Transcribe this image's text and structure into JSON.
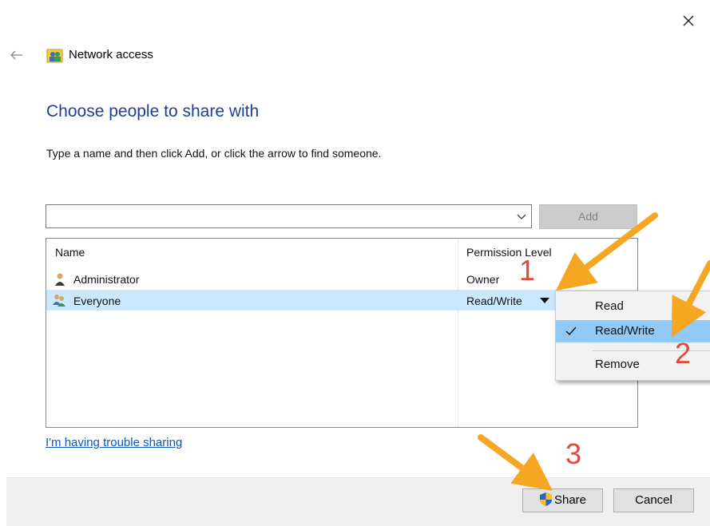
{
  "window": {
    "title": "Network access",
    "close_icon": "close-icon",
    "back_icon": "back-arrow-icon",
    "title_icon": "network-users-icon"
  },
  "main": {
    "heading": "Choose people to share with",
    "instruction": "Type a name and then click Add, or click the arrow to find someone.",
    "name_input": {
      "value": "",
      "placeholder": ""
    },
    "add_label": "Add",
    "trouble_link": "I'm having trouble sharing"
  },
  "list": {
    "columns": [
      "Name",
      "Permission Level"
    ],
    "rows": [
      {
        "name": "Administrator",
        "permission": "Owner",
        "icon": "user-icon",
        "selected": false
      },
      {
        "name": "Everyone",
        "permission": "Read/Write",
        "icon": "group-users-icon",
        "selected": true
      }
    ]
  },
  "context_menu": {
    "items": [
      {
        "label": "Read",
        "checked": false
      },
      {
        "label": "Read/Write",
        "checked": true
      },
      {
        "label": "Remove",
        "checked": false
      }
    ]
  },
  "footer": {
    "share_label": "Share",
    "cancel_label": "Cancel"
  },
  "annotations": {
    "steps": [
      "1",
      "2",
      "3"
    ],
    "arrow_color": "#f5a623",
    "number_color": "#e04a3c"
  },
  "colors": {
    "heading": "#1e3f9a",
    "selection": "#cce8ff",
    "menu_highlight": "#91c9f7",
    "link": "#0a58b8"
  }
}
